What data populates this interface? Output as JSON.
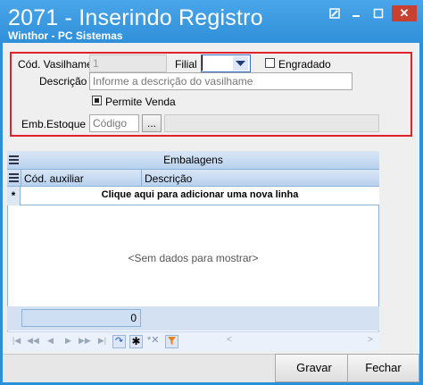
{
  "window": {
    "title": "2071 - Inserindo Registro",
    "subtitle": "Winthor - PC Sistemas",
    "close_glyph": "✕"
  },
  "form": {
    "cod_vasilhame_label": "Cód. Vasilhame",
    "cod_vasilhame_value": "1",
    "filial_label": "Filial",
    "filial_value": "",
    "engradado_label": "Engradado",
    "engradado_checked": false,
    "descricao_label": "Descrição",
    "descricao_placeholder": "Informe a descrição do vasilhame",
    "permite_venda_label": "Permite Venda",
    "permite_venda_checked": true,
    "emb_estoque_label": "Emb.Estoque",
    "emb_estoque_placeholder": "Código",
    "ellipsis_label": "...",
    "emb_estoque_desc_value": ""
  },
  "grid": {
    "title": "Embalagens",
    "columns": [
      "Cód. auxiliar",
      "Descrição"
    ],
    "new_row_text": "Clique aqui para adicionar uma nova linha",
    "new_row_marker": "*",
    "empty_text": "<Sem dados para mostrar>",
    "footer_count": "0"
  },
  "navigator": {
    "icons": [
      "first-icon",
      "prev-page-icon",
      "prev-icon",
      "next-icon",
      "next-page-icon",
      "last-icon",
      "refresh-icon",
      "insert-icon",
      "delete-icon",
      "filter-icon"
    ]
  },
  "buttons": {
    "gravar": "Gravar",
    "fechar": "Fechar"
  },
  "colors": {
    "titlebar": "#2f8fd8",
    "highlight_border": "#e0232b",
    "grid_header": "#b8d1ee"
  }
}
